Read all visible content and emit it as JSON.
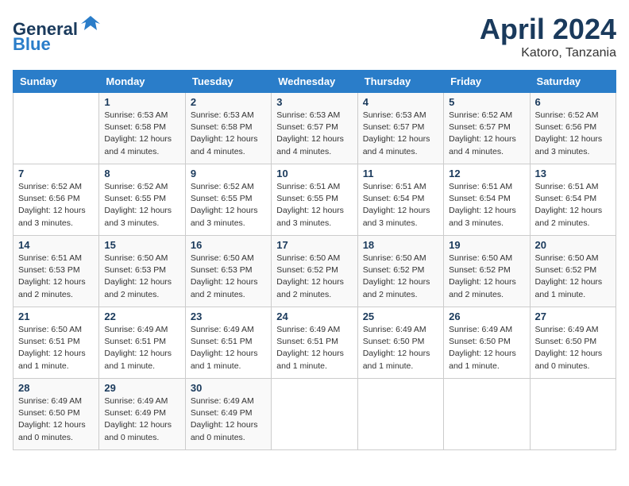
{
  "header": {
    "logo_line1": "General",
    "logo_line2": "Blue",
    "month": "April 2024",
    "location": "Katoro, Tanzania"
  },
  "weekdays": [
    "Sunday",
    "Monday",
    "Tuesday",
    "Wednesday",
    "Thursday",
    "Friday",
    "Saturday"
  ],
  "weeks": [
    [
      {
        "day": "",
        "sunrise": "",
        "sunset": "",
        "daylight": ""
      },
      {
        "day": "1",
        "sunrise": "Sunrise: 6:53 AM",
        "sunset": "Sunset: 6:58 PM",
        "daylight": "Daylight: 12 hours and 4 minutes."
      },
      {
        "day": "2",
        "sunrise": "Sunrise: 6:53 AM",
        "sunset": "Sunset: 6:58 PM",
        "daylight": "Daylight: 12 hours and 4 minutes."
      },
      {
        "day": "3",
        "sunrise": "Sunrise: 6:53 AM",
        "sunset": "Sunset: 6:57 PM",
        "daylight": "Daylight: 12 hours and 4 minutes."
      },
      {
        "day": "4",
        "sunrise": "Sunrise: 6:53 AM",
        "sunset": "Sunset: 6:57 PM",
        "daylight": "Daylight: 12 hours and 4 minutes."
      },
      {
        "day": "5",
        "sunrise": "Sunrise: 6:52 AM",
        "sunset": "Sunset: 6:57 PM",
        "daylight": "Daylight: 12 hours and 4 minutes."
      },
      {
        "day": "6",
        "sunrise": "Sunrise: 6:52 AM",
        "sunset": "Sunset: 6:56 PM",
        "daylight": "Daylight: 12 hours and 3 minutes."
      }
    ],
    [
      {
        "day": "7",
        "sunrise": "Sunrise: 6:52 AM",
        "sunset": "Sunset: 6:56 PM",
        "daylight": "Daylight: 12 hours and 3 minutes."
      },
      {
        "day": "8",
        "sunrise": "Sunrise: 6:52 AM",
        "sunset": "Sunset: 6:55 PM",
        "daylight": "Daylight: 12 hours and 3 minutes."
      },
      {
        "day": "9",
        "sunrise": "Sunrise: 6:52 AM",
        "sunset": "Sunset: 6:55 PM",
        "daylight": "Daylight: 12 hours and 3 minutes."
      },
      {
        "day": "10",
        "sunrise": "Sunrise: 6:51 AM",
        "sunset": "Sunset: 6:55 PM",
        "daylight": "Daylight: 12 hours and 3 minutes."
      },
      {
        "day": "11",
        "sunrise": "Sunrise: 6:51 AM",
        "sunset": "Sunset: 6:54 PM",
        "daylight": "Daylight: 12 hours and 3 minutes."
      },
      {
        "day": "12",
        "sunrise": "Sunrise: 6:51 AM",
        "sunset": "Sunset: 6:54 PM",
        "daylight": "Daylight: 12 hours and 3 minutes."
      },
      {
        "day": "13",
        "sunrise": "Sunrise: 6:51 AM",
        "sunset": "Sunset: 6:54 PM",
        "daylight": "Daylight: 12 hours and 2 minutes."
      }
    ],
    [
      {
        "day": "14",
        "sunrise": "Sunrise: 6:51 AM",
        "sunset": "Sunset: 6:53 PM",
        "daylight": "Daylight: 12 hours and 2 minutes."
      },
      {
        "day": "15",
        "sunrise": "Sunrise: 6:50 AM",
        "sunset": "Sunset: 6:53 PM",
        "daylight": "Daylight: 12 hours and 2 minutes."
      },
      {
        "day": "16",
        "sunrise": "Sunrise: 6:50 AM",
        "sunset": "Sunset: 6:53 PM",
        "daylight": "Daylight: 12 hours and 2 minutes."
      },
      {
        "day": "17",
        "sunrise": "Sunrise: 6:50 AM",
        "sunset": "Sunset: 6:52 PM",
        "daylight": "Daylight: 12 hours and 2 minutes."
      },
      {
        "day": "18",
        "sunrise": "Sunrise: 6:50 AM",
        "sunset": "Sunset: 6:52 PM",
        "daylight": "Daylight: 12 hours and 2 minutes."
      },
      {
        "day": "19",
        "sunrise": "Sunrise: 6:50 AM",
        "sunset": "Sunset: 6:52 PM",
        "daylight": "Daylight: 12 hours and 2 minutes."
      },
      {
        "day": "20",
        "sunrise": "Sunrise: 6:50 AM",
        "sunset": "Sunset: 6:52 PM",
        "daylight": "Daylight: 12 hours and 1 minute."
      }
    ],
    [
      {
        "day": "21",
        "sunrise": "Sunrise: 6:50 AM",
        "sunset": "Sunset: 6:51 PM",
        "daylight": "Daylight: 12 hours and 1 minute."
      },
      {
        "day": "22",
        "sunrise": "Sunrise: 6:49 AM",
        "sunset": "Sunset: 6:51 PM",
        "daylight": "Daylight: 12 hours and 1 minute."
      },
      {
        "day": "23",
        "sunrise": "Sunrise: 6:49 AM",
        "sunset": "Sunset: 6:51 PM",
        "daylight": "Daylight: 12 hours and 1 minute."
      },
      {
        "day": "24",
        "sunrise": "Sunrise: 6:49 AM",
        "sunset": "Sunset: 6:51 PM",
        "daylight": "Daylight: 12 hours and 1 minute."
      },
      {
        "day": "25",
        "sunrise": "Sunrise: 6:49 AM",
        "sunset": "Sunset: 6:50 PM",
        "daylight": "Daylight: 12 hours and 1 minute."
      },
      {
        "day": "26",
        "sunrise": "Sunrise: 6:49 AM",
        "sunset": "Sunset: 6:50 PM",
        "daylight": "Daylight: 12 hours and 1 minute."
      },
      {
        "day": "27",
        "sunrise": "Sunrise: 6:49 AM",
        "sunset": "Sunset: 6:50 PM",
        "daylight": "Daylight: 12 hours and 0 minutes."
      }
    ],
    [
      {
        "day": "28",
        "sunrise": "Sunrise: 6:49 AM",
        "sunset": "Sunset: 6:50 PM",
        "daylight": "Daylight: 12 hours and 0 minutes."
      },
      {
        "day": "29",
        "sunrise": "Sunrise: 6:49 AM",
        "sunset": "Sunset: 6:49 PM",
        "daylight": "Daylight: 12 hours and 0 minutes."
      },
      {
        "day": "30",
        "sunrise": "Sunrise: 6:49 AM",
        "sunset": "Sunset: 6:49 PM",
        "daylight": "Daylight: 12 hours and 0 minutes."
      },
      {
        "day": "",
        "sunrise": "",
        "sunset": "",
        "daylight": ""
      },
      {
        "day": "",
        "sunrise": "",
        "sunset": "",
        "daylight": ""
      },
      {
        "day": "",
        "sunrise": "",
        "sunset": "",
        "daylight": ""
      },
      {
        "day": "",
        "sunrise": "",
        "sunset": "",
        "daylight": ""
      }
    ]
  ]
}
